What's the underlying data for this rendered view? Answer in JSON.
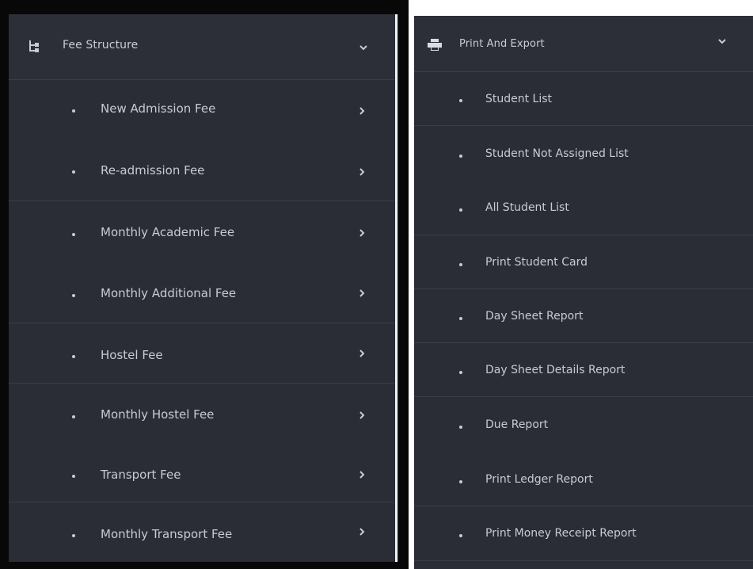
{
  "left_menu": {
    "header": {
      "label": "Fee Structure",
      "icon": "sitemap-icon",
      "toggle_icon": "chevron-down-icon"
    },
    "items": [
      {
        "label": "New Admission Fee",
        "icon": "chevron-right-icon"
      },
      {
        "label": "Re-admission Fee",
        "icon": "chevron-right-icon"
      },
      {
        "label": "Monthly Academic Fee",
        "icon": "chevron-right-icon"
      },
      {
        "label": "Monthly Additional Fee",
        "icon": "chevron-right-icon"
      },
      {
        "label": "Hostel Fee",
        "icon": "chevron-right-icon"
      },
      {
        "label": "Monthly Hostel Fee",
        "icon": "chevron-right-icon"
      },
      {
        "label": "Transport Fee",
        "icon": "chevron-right-icon"
      },
      {
        "label": "Monthly Transport Fee",
        "icon": "chevron-right-icon"
      }
    ]
  },
  "right_menu": {
    "header": {
      "label": "Print And Export",
      "icon": "printer-icon",
      "toggle_icon": "chevron-down-icon"
    },
    "items": [
      {
        "label": "Student List"
      },
      {
        "label": "Student Not Assigned List"
      },
      {
        "label": "All Student List"
      },
      {
        "label": "Print Student Card"
      },
      {
        "label": "Day Sheet Report"
      },
      {
        "label": "Day Sheet Details Report"
      },
      {
        "label": "Due Report"
      },
      {
        "label": "Print Ledger Report"
      },
      {
        "label": "Print Money Receipt Report"
      }
    ]
  },
  "colors": {
    "panel_bg": "#2a2d36",
    "text": "#c6cbd4",
    "divider": "#3a3e48"
  }
}
